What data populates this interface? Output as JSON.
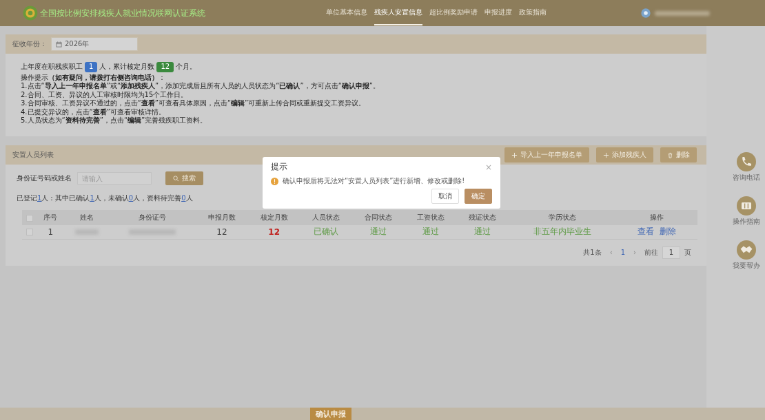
{
  "header": {
    "title": "全国按比例安排残疾人就业情况联网认证系统",
    "nav": [
      {
        "label": "单位基本信息",
        "selected": false
      },
      {
        "label": "残疾人安置信息",
        "selected": true
      },
      {
        "label": "超比例奖励申请",
        "selected": false
      },
      {
        "label": "申报进度",
        "selected": false
      },
      {
        "label": "政策指南",
        "selected": false
      }
    ],
    "user": {
      "redacted": true
    }
  },
  "year_filter": {
    "label": "征收年份：",
    "value": "2026年"
  },
  "notice": {
    "summary": [
      {
        "kind": "text",
        "text": "上年度在职残疾职工"
      },
      {
        "kind": "badge",
        "text": "1",
        "color": "#3d72c4"
      },
      {
        "kind": "text",
        "text": "人，累计核定月数"
      },
      {
        "kind": "badge",
        "text": "12",
        "color": "#3b8a3e"
      },
      {
        "kind": "text",
        "text": "个月。"
      }
    ],
    "tip_title": "操作提示**（如有疑问，请拨打右侧咨询电话）**：",
    "tips": [
      "1.点击“**导入上一年申报名单**”或“**添加残疾人**”，添加完成后且所有人员的人员状态为“**已确认**”，方可点击“**确认申报**”。",
      "2.合同、工资、异议的人工审核时限均为15个工作日。",
      "3.合同审核、工资异议不通过的，点击“**查看**”可查看具体原因，点击“**编辑**”可重新上传合同或重新提交工资异议。",
      "4.已提交异议的，点击“**查看**”可查看审核详情。",
      "5.人员状态为“**资料待完善**”，点击“**编辑**”完善残疾职工资料。"
    ]
  },
  "list": {
    "title": "安置人员列表",
    "buttons": [
      {
        "label": "导入上一年申报名单",
        "kind": "plus"
      },
      {
        "label": "添加残疾人",
        "kind": "plus"
      },
      {
        "label": "删除",
        "kind": "trash"
      }
    ],
    "search": {
      "label": "身份证号码或姓名",
      "placeholder": "请输入",
      "button": "搜索"
    },
    "stats": [
      {
        "kind": "text",
        "text": "已登记"
      },
      {
        "kind": "link",
        "text": "1"
      },
      {
        "kind": "text",
        "text": "人：其中已确认"
      },
      {
        "kind": "link",
        "text": "1"
      },
      {
        "kind": "text",
        "text": "人，未确认"
      },
      {
        "kind": "link",
        "text": "0"
      },
      {
        "kind": "text",
        "text": "人，资料待完善"
      },
      {
        "kind": "link",
        "text": "0"
      },
      {
        "kind": "text",
        "text": "人"
      }
    ],
    "select_all": {
      "checked": false
    },
    "columns": [
      "序号",
      "姓名",
      "身份证号",
      "申报月数",
      "核定月数",
      "人员状态",
      "合同状态",
      "工资状态",
      "残证状态",
      "学历状态",
      "操作"
    ],
    "rows": [
      {
        "checked": false,
        "cells": [
          {
            "kind": "text",
            "color": "#444444",
            "text": "1"
          },
          {
            "kind": "redacted"
          },
          {
            "kind": "redacted"
          },
          {
            "kind": "text",
            "color": "#444444",
            "text": "12"
          },
          {
            "kind": "text",
            "color": "#c0211e",
            "text": "12"
          },
          {
            "kind": "text",
            "color": "#5d9a44",
            "text": "已确认"
          },
          {
            "kind": "text",
            "color": "#5d9a44",
            "text": "通过"
          },
          {
            "kind": "text",
            "color": "#5d9a44",
            "text": "通过"
          },
          {
            "kind": "text",
            "color": "#5d9a44",
            "text": "通过"
          },
          {
            "kind": "text",
            "color": "#5d9a44",
            "text": "非五年内毕业生"
          },
          {
            "kind": "actions",
            "actions": [
              "查看",
              "删除"
            ]
          }
        ]
      }
    ],
    "pagination": {
      "total": "共1条",
      "prev": "‹",
      "pages": [
        {
          "label": "1",
          "selected": true
        }
      ],
      "next": "›",
      "goto_label": "前往",
      "goto_value": "1",
      "unit": "页"
    }
  },
  "side_tools": [
    {
      "kind": "phone",
      "label": "咨询电话"
    },
    {
      "kind": "guide",
      "label": "操作指南"
    },
    {
      "kind": "help",
      "label": "我要帮办"
    }
  ],
  "dialog": {
    "title": "提示",
    "close": "×",
    "message": "确认申报后将无法对“安置人员列表”进行新增、修改或删除!",
    "buttons": [
      {
        "label": "取消",
        "kind": "secondary"
      },
      {
        "label": "确定",
        "kind": "primary"
      }
    ]
  },
  "footer": {
    "button": "确认申报"
  }
}
